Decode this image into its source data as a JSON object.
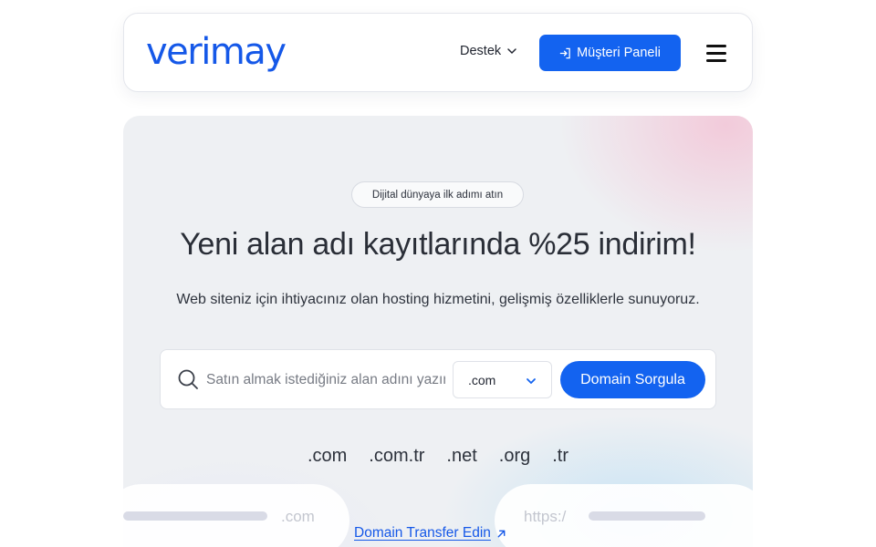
{
  "header": {
    "logo": "verimay",
    "support_label": "Destek",
    "panel_label": "Müşteri Paneli"
  },
  "hero": {
    "badge": "Dijital dünyaya ilk adımı atın",
    "headline": "Yeni alan adı kayıtlarında %25 indirim!",
    "subtext": "Web siteniz için ihtiyacınız olan hosting hizmetini, gelişmiş özelliklerle sunuyoruz.",
    "search": {
      "placeholder": "Satın almak istediğiniz alan adını yazın",
      "value": ""
    },
    "tld_selected": ".com",
    "query_label": "Domain Sorgula",
    "tlds": [
      ".com",
      ".com.tr",
      ".net",
      ".org",
      ".tr"
    ],
    "deco_left_label": ".com",
    "deco_right_label": "https:/",
    "transfer_label": "Domain Transfer Edin"
  },
  "colors": {
    "brand": "#1558e8",
    "button": "#1363f0",
    "background": "#eef0f3"
  },
  "icons": {
    "support": "chevron-down-icon",
    "panel": "login-icon",
    "menu": "hamburger-icon",
    "search": "search-icon",
    "select": "chevron-down-icon",
    "transfer": "arrow-up-right-icon"
  }
}
